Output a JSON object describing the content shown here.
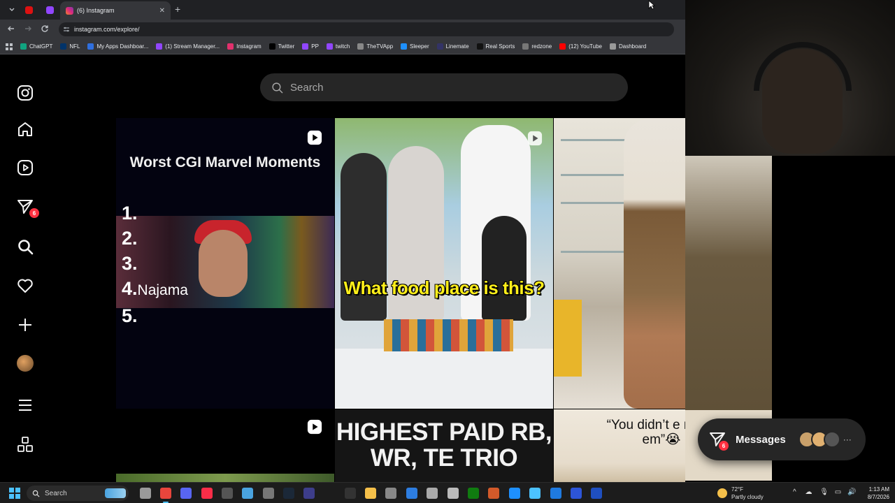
{
  "browser": {
    "active_tab_title": "(6) Instagram",
    "new_tab_symbol": "+",
    "close_symbol": "✕",
    "url": "instagram.com/explore/",
    "bookmarks": [
      {
        "label": "ChatGPT",
        "color": "#10a37f"
      },
      {
        "label": "NFL",
        "color": "#013369"
      },
      {
        "label": "My Apps Dashboar...",
        "color": "#2f6fde"
      },
      {
        "label": "(1) Stream Manager...",
        "color": "#9146ff"
      },
      {
        "label": "Instagram",
        "color": "#e1306c"
      },
      {
        "label": "Twitter",
        "color": "#000000"
      },
      {
        "label": "PP",
        "color": "#9146ff"
      },
      {
        "label": "twitch",
        "color": "#9146ff"
      },
      {
        "label": "TheTVApp",
        "color": "#888888"
      },
      {
        "label": "Sleeper",
        "color": "#1e90ff"
      },
      {
        "label": "Linemate",
        "color": "#333366"
      },
      {
        "label": "Real Sports",
        "color": "#111111"
      },
      {
        "label": "redzone",
        "color": "#777777"
      },
      {
        "label": "(12) YouTube",
        "color": "#ff0000"
      },
      {
        "label": "Dashboard",
        "color": "#999999"
      }
    ]
  },
  "instagram": {
    "search_placeholder": "Search",
    "notifications_badge": "6",
    "tiles": {
      "t1_title": "Worst CGI Marvel Moments",
      "t1_list": [
        "1.",
        "2.",
        "3.",
        "4.",
        "5."
      ],
      "t1_item4": "Najama",
      "t2_caption": "What food place is this?",
      "t5_headline": "HIGHEST PAID RB, WR, TE TRIO",
      "t6_quote": "“You didn’t e make em”😭"
    },
    "messages": {
      "label": "Messages",
      "badge": "6",
      "more": "···"
    }
  },
  "taskbar": {
    "search_label": "Search",
    "weather_temp": "72°F",
    "weather_desc": "Partly cloudy",
    "time": "1:13 AM",
    "date": "8/7/2026",
    "tray_chevron": "^"
  },
  "colors": {
    "accent_blue": "#4cc2ff",
    "badge_red": "#ff3040",
    "caption_yellow": "#ffef1a"
  }
}
